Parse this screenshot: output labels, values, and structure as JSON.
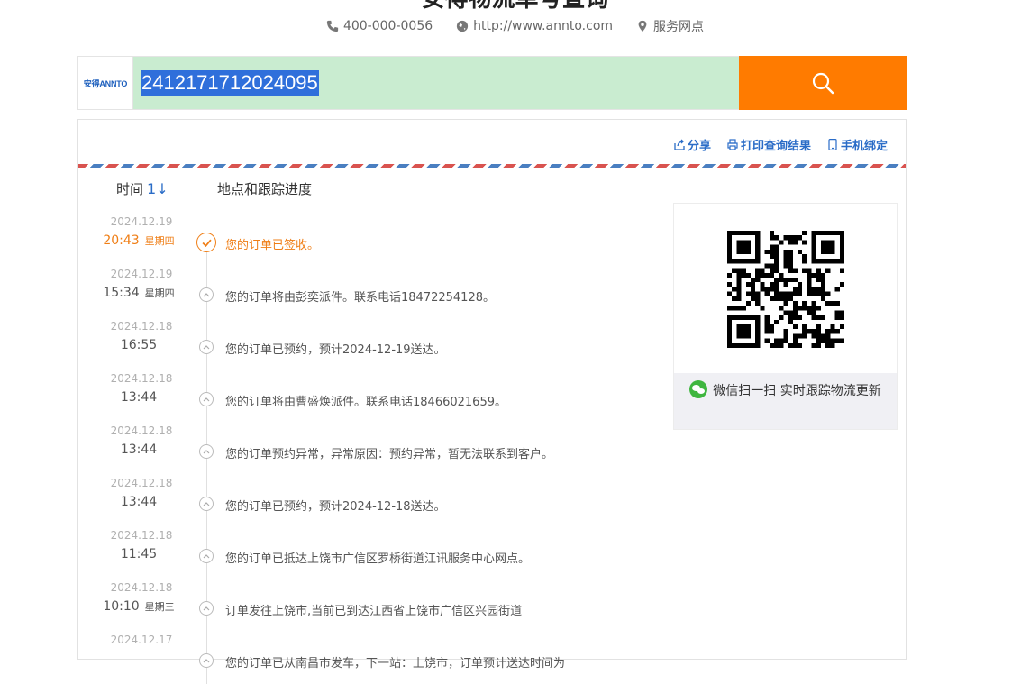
{
  "header": {
    "title": "安得物流单号查询",
    "phone": "400-000-0056",
    "website": "http://www.annto.com",
    "service": "服务网点"
  },
  "search": {
    "logo_text": "安得ANNTO",
    "value": "2412171712024095",
    "button_icon": "search-icon"
  },
  "actions": {
    "share": "分享",
    "print": "打印查询结果",
    "bind": "手机绑定"
  },
  "columns": {
    "time": "时间",
    "sort_glyph": "1↓",
    "place": "地点和跟踪进度"
  },
  "timeline": [
    {
      "date": "2024.12.19",
      "time": "20:43",
      "week": "星期四",
      "text": "您的订单已签收。",
      "current": true
    },
    {
      "date": "2024.12.19",
      "time": "15:34",
      "week": "星期四",
      "text": "您的订单将由彭奕派件。联系电话18472254128。"
    },
    {
      "date": "2024.12.18",
      "time": "16:55",
      "week": "",
      "text": "您的订单已预约，预计2024-12-19送达。"
    },
    {
      "date": "2024.12.18",
      "time": "13:44",
      "week": "",
      "text": "您的订单将由曹盛焕派件。联系电话18466021659。"
    },
    {
      "date": "2024.12.18",
      "time": "13:44",
      "week": "",
      "text": "您的订单预约异常，异常原因：预约异常，暂无法联系到客户。"
    },
    {
      "date": "2024.12.18",
      "time": "13:44",
      "week": "",
      "text": "您的订单已预约，预计2024-12-18送达。"
    },
    {
      "date": "2024.12.18",
      "time": "11:45",
      "week": "",
      "text": "您的订单已抵达上饶市广信区罗桥街道江讯服务中心网点。"
    },
    {
      "date": "2024.12.18",
      "time": "10:10",
      "week": "星期三",
      "text": "订单发往上饶市,当前已到达江西省上饶市广信区兴园街道"
    },
    {
      "date": "2024.12.17",
      "time": "",
      "week": "",
      "text": "您的订单已从南昌市发车，下一站：上饶市，订单预计送达时间为"
    }
  ],
  "qr": {
    "caption": "微信扫一扫 实时跟踪物流更新"
  },
  "colors": {
    "accent_orange": "#ff7b00",
    "link_blue": "#2a6cc7",
    "input_bg": "#c9ecd0"
  }
}
